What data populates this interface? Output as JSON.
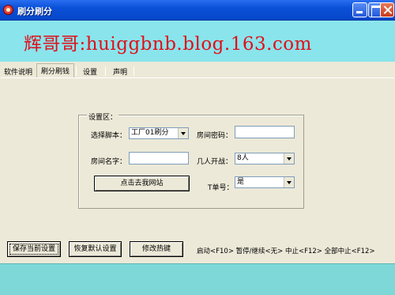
{
  "window": {
    "title": "刷分刷分"
  },
  "banner": {
    "text": "辉哥哥:huiggbnb.blog.163.com"
  },
  "tabs": [
    {
      "label": "软件说明",
      "active": false
    },
    {
      "label": "刷分刷钱",
      "active": true
    },
    {
      "label": "设置",
      "active": false
    },
    {
      "label": "声明",
      "active": false
    }
  ],
  "settings": {
    "group_label": "设置区：",
    "script_label": "选择脚本：",
    "script_value": "工厂01刷分",
    "room_password_label": "房间密码：",
    "room_password_value": "",
    "room_name_label": "房间名字：",
    "room_name_value": "",
    "players_label": "几人开战：",
    "players_value": "8人",
    "visit_url_button": "点击去我网站",
    "t_count_label": "T单号：",
    "t_count_value": "是"
  },
  "actions": {
    "save_button": "保存当前设置",
    "restore_button": "恢复默认设置",
    "hotkey_button": "修改热键"
  },
  "hotkeys_text": "启动<F10> 暂停/继续<无> 中止<F12> 全部中止<F12>",
  "colors": {
    "banner_bg": "#8ae4ec",
    "banner_text": "#e0101a",
    "window_bg": "#ece9d8",
    "title_bar": "#0a50d8"
  }
}
